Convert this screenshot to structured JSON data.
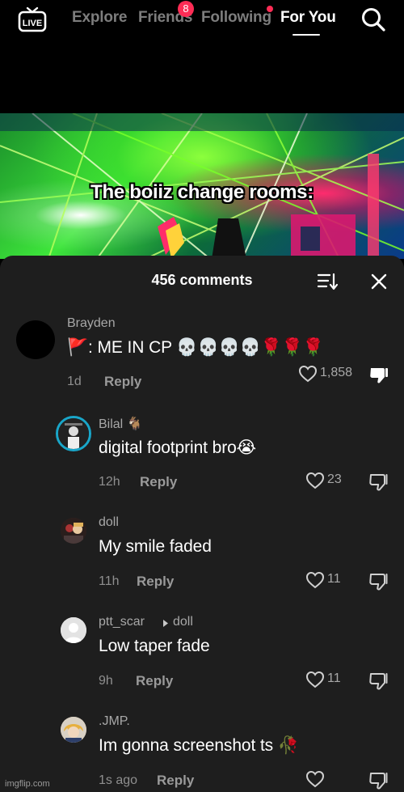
{
  "top_nav": {
    "live_label": "LIVE",
    "tabs": [
      {
        "label": "Explore"
      },
      {
        "label": "Friends"
      },
      {
        "label": "Following"
      },
      {
        "label": "For You"
      }
    ],
    "friends_badge": "8",
    "active_tab": "For You",
    "accent_color": "#fe2c55"
  },
  "video": {
    "caption": "The boiiz change rooms:"
  },
  "comments_panel": {
    "title": "456 comments",
    "sort_icon": "sort-icon",
    "close_icon": "close-icon",
    "comments": [
      {
        "username": "Brayden",
        "text": "🚩: ME IN CP 💀💀💀💀🌹🌹🌹",
        "time": "1d",
        "reply_label": "Reply",
        "likes": "1,858",
        "disliked": true
      },
      {
        "username": "Bilal 🐐",
        "text": "digital footprint bro😭",
        "time": "12h",
        "reply_label": "Reply",
        "likes": "23",
        "disliked": false
      },
      {
        "username": "doll",
        "text": "My smile faded",
        "time": "11h",
        "reply_label": "Reply",
        "likes": "11",
        "disliked": false
      },
      {
        "username": "ptt_scar",
        "reply_to": "doll",
        "text": "Low taper fade",
        "time": "9h",
        "reply_label": "Reply",
        "likes": "11",
        "disliked": false
      },
      {
        "username": ".JMP.",
        "text": "Im gonna screenshot ts 🥀",
        "time": "1s ago",
        "reply_label": "Reply",
        "likes": "",
        "disliked": false
      }
    ]
  },
  "watermark": "imgflip.com"
}
